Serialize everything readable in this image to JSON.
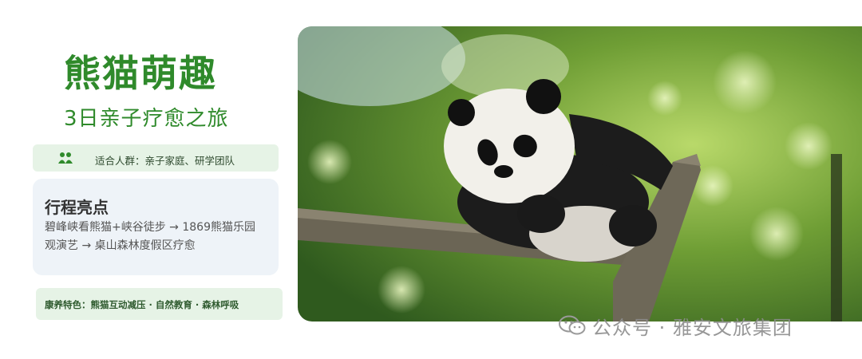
{
  "title": "熊猫萌趣",
  "subtitle": "3日亲子疗愈之旅",
  "audience": {
    "icon": "people-icon",
    "text": "适合人群：亲子家庭、研学团队"
  },
  "highlights": {
    "heading": "行程亮点",
    "line1": "碧峰峡看熊猫+峡谷徒步 → 1869熊猫乐园",
    "line2": "观演艺 → 桌山森林度假区疗愈"
  },
  "feature": {
    "text": "康养特色：熊猫互动减压 · 自然教育 · 森林呼吸"
  },
  "watermark": {
    "icon": "wechat-icon",
    "text": "公众号 · 雅安文旅集团"
  },
  "colors": {
    "accent_green": "#2f8a2b",
    "badge_bg": "#e6f3e6",
    "card_bg": "#eef3f8"
  }
}
